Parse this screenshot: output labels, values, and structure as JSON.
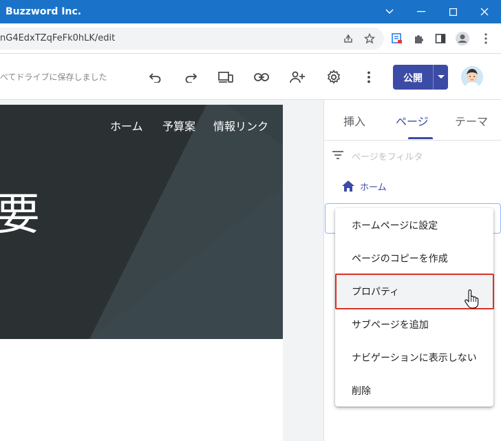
{
  "window": {
    "title": "Buzzword Inc."
  },
  "address_bar": {
    "url": "nG4EdxTZqFeFk0hLK/edit"
  },
  "editor": {
    "saved_status": "べてドライブに保存しました",
    "publish_label": "公開"
  },
  "site": {
    "nav": [
      "ホーム",
      "予算案",
      "情報リンク"
    ],
    "hero_title": "要"
  },
  "panel": {
    "tabs": [
      "挿入",
      "ページ",
      "テーマ"
    ],
    "active_tab": "ページ",
    "filter_placeholder": "ページをフィルタ",
    "home_page": "ホーム"
  },
  "context_menu": {
    "items": [
      "ホームページに設定",
      "ページのコピーを作成",
      "プロパティ",
      "サブページを追加",
      "ナビゲーションに表示しない",
      "削除"
    ],
    "highlighted": "プロパティ"
  },
  "colors": {
    "titlebar": "#1a73c9",
    "accent": "#3c4ba5",
    "highlight_border": "#d93025"
  }
}
